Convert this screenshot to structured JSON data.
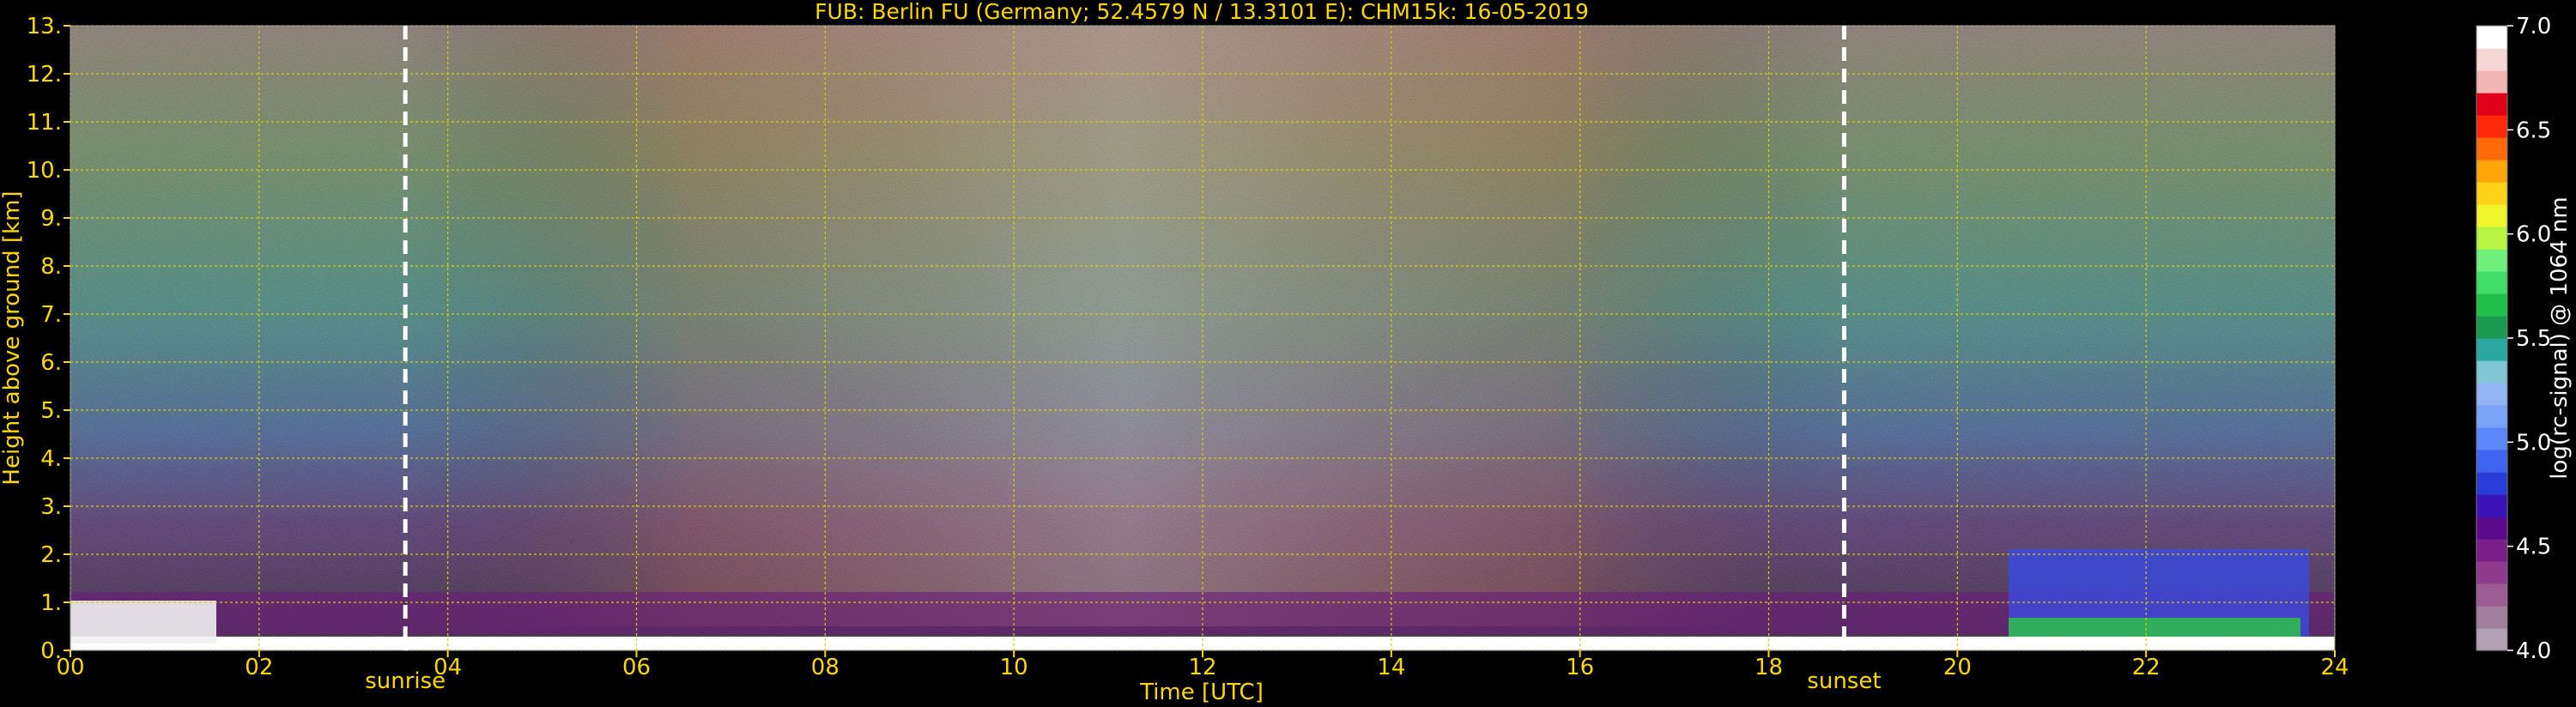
{
  "chart_data": {
    "type": "heatmap",
    "title": "FUB: Berlin FU (Germany; 52.4579 N / 13.3101 E):    CHM15k: 16-05-2019",
    "xlabel": "Time [UTC]",
    "ylabel": "Height above ground [km]",
    "xlim": [
      0,
      24
    ],
    "ylim": [
      0,
      13
    ],
    "x_ticks": [
      "00",
      "02",
      "04",
      "06",
      "08",
      "10",
      "12",
      "14",
      "16",
      "18",
      "20",
      "22",
      "24"
    ],
    "y_ticks": [
      "0.",
      "1.",
      "2.",
      "3.",
      "4.",
      "5.",
      "6.",
      "7.",
      "8.",
      "9.",
      "10.",
      "11.",
      "12.",
      "13."
    ],
    "grid": true,
    "colorbar": {
      "label": "log(rc-signal) @ 1064 nm",
      "range": [
        4.0,
        7.0
      ],
      "ticks": [
        "4.0",
        "4.5",
        "5.0",
        "5.5",
        "6.0",
        "6.5",
        "7.0"
      ],
      "colors": [
        "#b3a2b3",
        "#a2809c",
        "#9c5c94",
        "#8e3b8e",
        "#7a1e8a",
        "#5c0a8e",
        "#3a14b8",
        "#2a3cd8",
        "#3f64f0",
        "#5a86f7",
        "#7aa2f7",
        "#93b4f5",
        "#7fc6d6",
        "#2aa8a0",
        "#1a9a50",
        "#1fbf4a",
        "#3fdc6a",
        "#6ff07a",
        "#b8f542",
        "#eef52a",
        "#ffd21a",
        "#ffa40a",
        "#ff6a0a",
        "#ff2a0a",
        "#e0001a",
        "#f2b6b6",
        "#f6d6d6",
        "#ffffff"
      ]
    },
    "annotations": [
      {
        "text": "sunrise",
        "x": 3.55
      },
      {
        "text": "sunset",
        "x": 18.8
      }
    ],
    "vertical_markers": [
      3.55,
      18.8
    ]
  }
}
